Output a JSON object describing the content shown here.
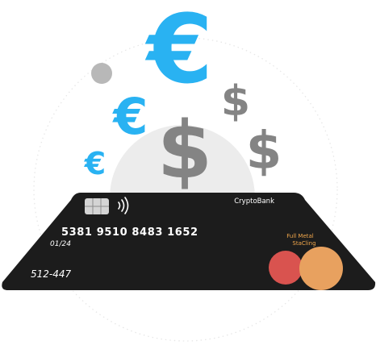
{
  "card": {
    "brand": "CryptoBank",
    "number": "5381 9510 8483 1652",
    "expiry": "01/24",
    "cvv_code": "512-447",
    "tagline_line1": "Full Metal",
    "tagline_line2": "StaCling"
  },
  "symbols": {
    "euro": "€",
    "dollar": "$"
  },
  "colors": {
    "euro_blue": "#29b2f2",
    "dollar_gray": "#848484",
    "card_black": "#1c1c1c",
    "accent_red": "#d9534f",
    "accent_orange": "#e8a15f",
    "tagline_orange": "#f0a64b"
  },
  "icons": [
    "chip-icon",
    "contactless-icon",
    "mastercard-logo"
  ]
}
